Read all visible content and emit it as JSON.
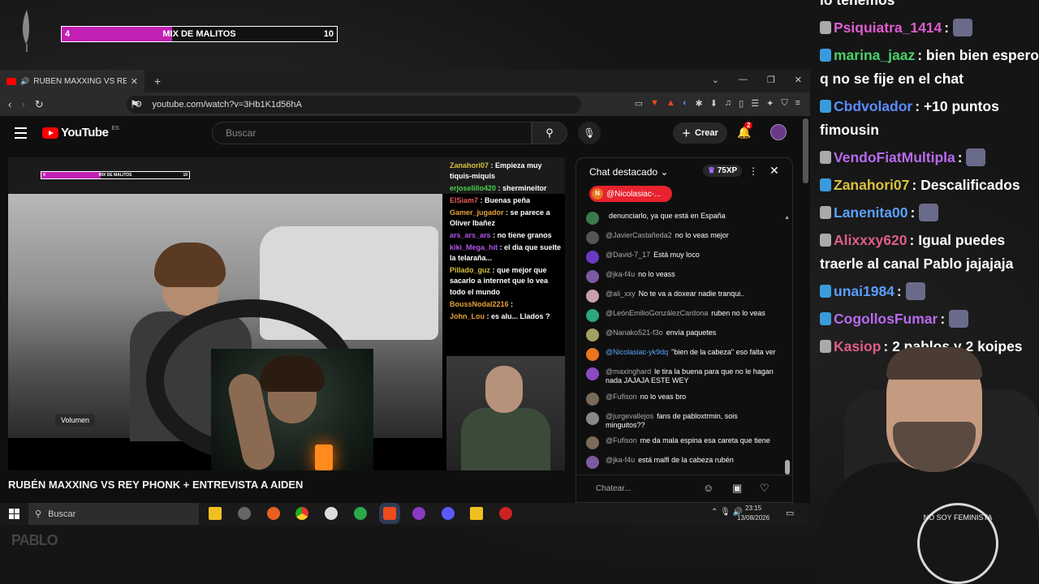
{
  "overlay": {
    "bar_left": "4",
    "bar_title": "MIX DE MALITOS",
    "bar_right": "10",
    "bar_progress": 0.4
  },
  "browser": {
    "tab_title": "RUBÉN MAXXING VS REY PHO",
    "url": "youtube.com/watch?v=3Hb1K1d56hA"
  },
  "youtube": {
    "logo_text": "YouTube",
    "logo_region": "ES",
    "search_placeholder": "Buscar",
    "create_label": "Crear",
    "notifications_count": "2",
    "video_title": "RUBÉN MAXXING VS REY PHONK + ENTREVISTA A AIDEN",
    "volume_tooltip": "Volumen"
  },
  "video_chat": [
    {
      "user": "Zanahori07",
      "text": "Empieza muy tiquis-miquis",
      "color": "u"
    },
    {
      "user": "erjoselillo420",
      "text": "shermineitor",
      "color": "u g"
    },
    {
      "user": "ElSiam7",
      "text": "Buenas peña",
      "color": "u r"
    },
    {
      "user": "Gamer_jugador",
      "text": "se parece a Oliver Ibañez",
      "color": "u o"
    },
    {
      "user": "ars_ars_ars",
      "text": "no tiene granos",
      "color": "u p"
    },
    {
      "user": "kiki_Mega_hit",
      "text": "el dia que suelte la telaraña...",
      "color": "u p"
    },
    {
      "user": "Pillado_guz",
      "text": "que mejor que sacarlo a internet que lo vea todo el mundo",
      "color": "u"
    },
    {
      "user": "BoussNodal2216",
      "text": "",
      "color": "u o"
    },
    {
      "user": "John_Lou",
      "text": "es alu... Llados ?",
      "color": "u o"
    }
  ],
  "live_chat": {
    "header": "Chat destacado",
    "xp": "75XP",
    "pinned_user": "@Nicolasiac-...",
    "pinned_initial": "N",
    "input_placeholder": "Chatear...",
    "messages": [
      {
        "user": "",
        "text": "denunciarlo, ya que está en España",
        "avatar": "#3a7a4a"
      },
      {
        "user": "@JavierCastañeda2",
        "text": "no lo veas mejor",
        "avatar": "#555"
      },
      {
        "user": "@David-7_17",
        "text": "Está muy loco",
        "avatar": "#6a3ac2"
      },
      {
        "user": "@jka-f4u",
        "text": "no lo veass",
        "avatar": "#7a5aa0"
      },
      {
        "user": "@ali_xxy",
        "text": "No te va a doxear nadie tranqui..",
        "avatar": "#c9a0b0"
      },
      {
        "user": "@LeónEmilioGonzálezCardona",
        "text": "ruben no lo veas",
        "avatar": "#2aa87a"
      },
      {
        "user": "@Nanako521-f3o",
        "text": "envía paquetes",
        "avatar": "#a0a060"
      },
      {
        "user": "@Nicolasiac-yk9dq",
        "text": "\"bien de la cabeza\" eso falta ver",
        "avatar": "#e8761e",
        "highlight": true
      },
      {
        "user": "@maxinghard",
        "text": "le tira la buena para que no le hagan nada JAJAJA ESTE WEY",
        "avatar": "#8a4ac2"
      },
      {
        "user": "@Fufison",
        "text": "no lo veas bro",
        "avatar": "#7a6a5a"
      },
      {
        "user": "@jurgevallejos",
        "text": "fans de pabloxtrmin, sois minguitos??",
        "avatar": "#888"
      },
      {
        "user": "@Fufison",
        "text": "me da mala espina esa careta que tiene",
        "avatar": "#7a6a5a"
      },
      {
        "user": "@jka-f4u",
        "text": "está malfi de la cabeza rubén",
        "avatar": "#7a5aa0"
      }
    ]
  },
  "taskbar": {
    "search_label": "Buscar",
    "time": "23:15",
    "date": "13/08/2026"
  },
  "twitch_chat": {
    "top_line": "lo tenemos",
    "messages": [
      {
        "user": "Psiquiatra_1414",
        "text": "",
        "color": "#e05cd0"
      },
      {
        "user": "marina_jaaz",
        "text": "bien bien espero q no se fije en el chat",
        "color": "#4ad06a"
      },
      {
        "user": "Cbdvolador",
        "text": "+10 puntos fimousin",
        "color": "#5a8cff"
      },
      {
        "user": "VendoFiatMultipla",
        "text": "",
        "color": "#b86af0"
      },
      {
        "user": "Zanahori07",
        "text": "Descalificados",
        "color": "#d7c23c"
      },
      {
        "user": "Lanenita00",
        "text": "",
        "color": "#5aa0ff"
      },
      {
        "user": "Alixxxy620",
        "text": "Igual puedes traerle al canal Pablo jajajaja",
        "color": "#e05c8a"
      },
      {
        "user": "unai1984",
        "text": "",
        "color": "#5aa0ff"
      },
      {
        "user": "CogollosFumar",
        "text": "",
        "color": "#b86af0"
      },
      {
        "user": "Kasiop",
        "text": "2 pablos y 2 koipes",
        "color": "#e05c8a"
      }
    ]
  },
  "streamer_shirt": "NO SOY FEMINISTA"
}
